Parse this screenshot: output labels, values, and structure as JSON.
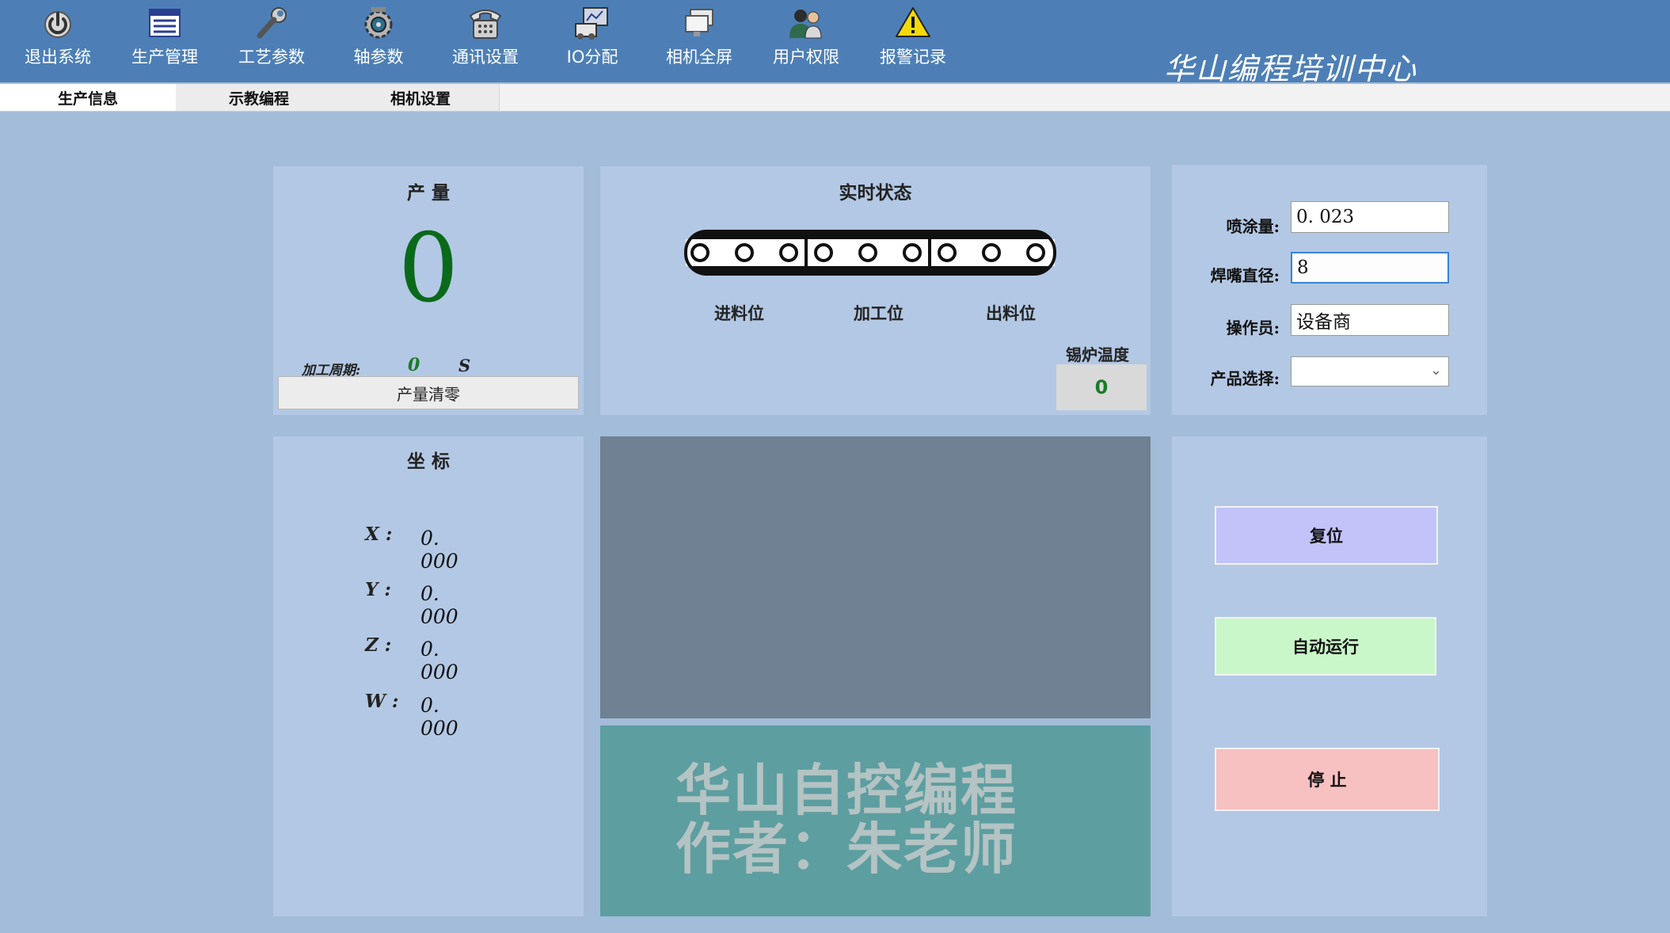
{
  "toolbar": {
    "items": [
      {
        "label": "退出系统",
        "icon": "power-icon"
      },
      {
        "label": "生产管理",
        "icon": "production-icon"
      },
      {
        "label": "工艺参数",
        "icon": "wrench-icon"
      },
      {
        "label": "轴参数",
        "icon": "axis-gear-icon"
      },
      {
        "label": "通讯设置",
        "icon": "telephone-icon"
      },
      {
        "label": "IO分配",
        "icon": "io-icon"
      },
      {
        "label": "相机全屏",
        "icon": "camera-fullscreen-icon"
      },
      {
        "label": "用户权限",
        "icon": "users-icon"
      },
      {
        "label": "报警记录",
        "icon": "warning-icon"
      }
    ],
    "brand": "华山编程培训中心"
  },
  "tabs": [
    "生产信息",
    "示教编程",
    "相机设置"
  ],
  "production": {
    "title": "产  量",
    "count": "0",
    "cycle_label": "加工周期:",
    "cycle_value": "0",
    "cycle_unit": "S",
    "clear_button": "产量清零"
  },
  "status": {
    "title": "实时状态",
    "stations": [
      "进料位",
      "加工位",
      "出料位"
    ],
    "boiler_label": "锡炉温度",
    "boiler_value": "0"
  },
  "params": {
    "spray_label": "喷涂量:",
    "spray_value": "0. 023",
    "nozzle_label": "焊嘴直径:",
    "nozzle_value": "8",
    "operator_label": "操作员:",
    "operator_value": "设备商",
    "product_label": "产品选择:",
    "product_value": ""
  },
  "coords": {
    "title": "坐  标",
    "rows": [
      {
        "label": "X :",
        "value": "0. 000"
      },
      {
        "label": "Y :",
        "value": "0. 000"
      },
      {
        "label": "Z :",
        "value": "0. 000"
      },
      {
        "label": "W :",
        "value": "0. 000"
      }
    ]
  },
  "watermark": {
    "line1": "华山自控编程",
    "line2": "作者：朱老师"
  },
  "actions": {
    "reset": "复位",
    "auto": "自动运行",
    "stop": "停  止"
  },
  "colors": {
    "toolbar_bg": "#4d7fb6",
    "page_bg": "#a3bcd9",
    "panel_bg": "#b3c8e4",
    "count_green": "#0a6a1a",
    "reset_btn": "#c2c3f8",
    "auto_btn": "#c9f7c9",
    "stop_btn": "#f7c0c1",
    "conveyor_marker": "#ef7a7a"
  }
}
